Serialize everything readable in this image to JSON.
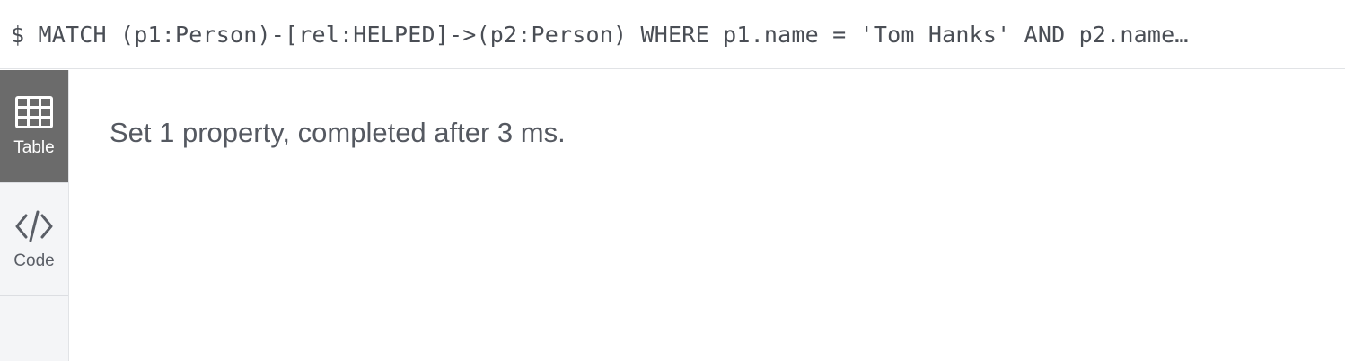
{
  "query": {
    "text": "$ MATCH (p1:Person)-[rel:HELPED]->(p2:Person) WHERE p1.name = 'Tom Hanks' AND p2.name…"
  },
  "sidebar": {
    "tabs": [
      {
        "label": "Table",
        "icon": "table-icon",
        "active": true
      },
      {
        "label": "Code",
        "icon": "code-icon",
        "active": false
      }
    ]
  },
  "result": {
    "message": "Set 1 property, completed after 3 ms."
  },
  "colors": {
    "active_tab_bg": "#6b6b6b",
    "sidebar_bg": "#f4f5f7",
    "text": "#555961"
  }
}
